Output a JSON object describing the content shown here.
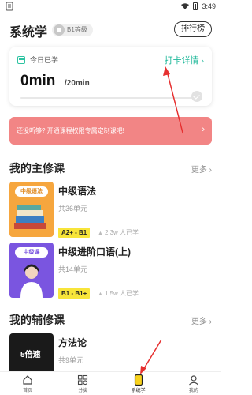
{
  "status_bar": {
    "time": "3:49"
  },
  "header": {
    "title": "系统学",
    "level_badge": "B1等级",
    "rank_button": "排行榜"
  },
  "study_card": {
    "today_label": "今日已学",
    "checkin_link": "打卡详情",
    "minutes": "0min",
    "goal": "/20min",
    "progress": 0
  },
  "promo_banner": {
    "text": "还没听够? 开通课程权限专属定制课吧!"
  },
  "main_courses": {
    "title": "我的主修课",
    "more": "更多",
    "items": [
      {
        "cover_label": "中级语法",
        "name": "中级语法",
        "units": "共36单元",
        "level": "A2+ - B1",
        "learners": "2.3w 人已学"
      },
      {
        "cover_label": "中级课",
        "name": "中级进阶口语(上)",
        "units": "共14单元",
        "level": "B1 - B1+",
        "learners": "1.5w 人已学"
      }
    ]
  },
  "minor_courses": {
    "title": "我的辅修课",
    "more": "更多",
    "items": [
      {
        "cover_label": "5倍速",
        "name": "方法论",
        "units": "共9单元"
      }
    ]
  },
  "bottom_nav": {
    "items": [
      {
        "label": "首页",
        "icon": "home-icon"
      },
      {
        "label": "分类",
        "icon": "category-grid-icon"
      },
      {
        "label": "系统学",
        "icon": "system-study-icon",
        "active": true
      },
      {
        "label": "我的",
        "icon": "profile-icon"
      }
    ]
  },
  "colors": {
    "accent": "#2ec4a2",
    "promo": "#f28585",
    "level_tag": "#f8e53a",
    "annotation": "#e63030"
  }
}
